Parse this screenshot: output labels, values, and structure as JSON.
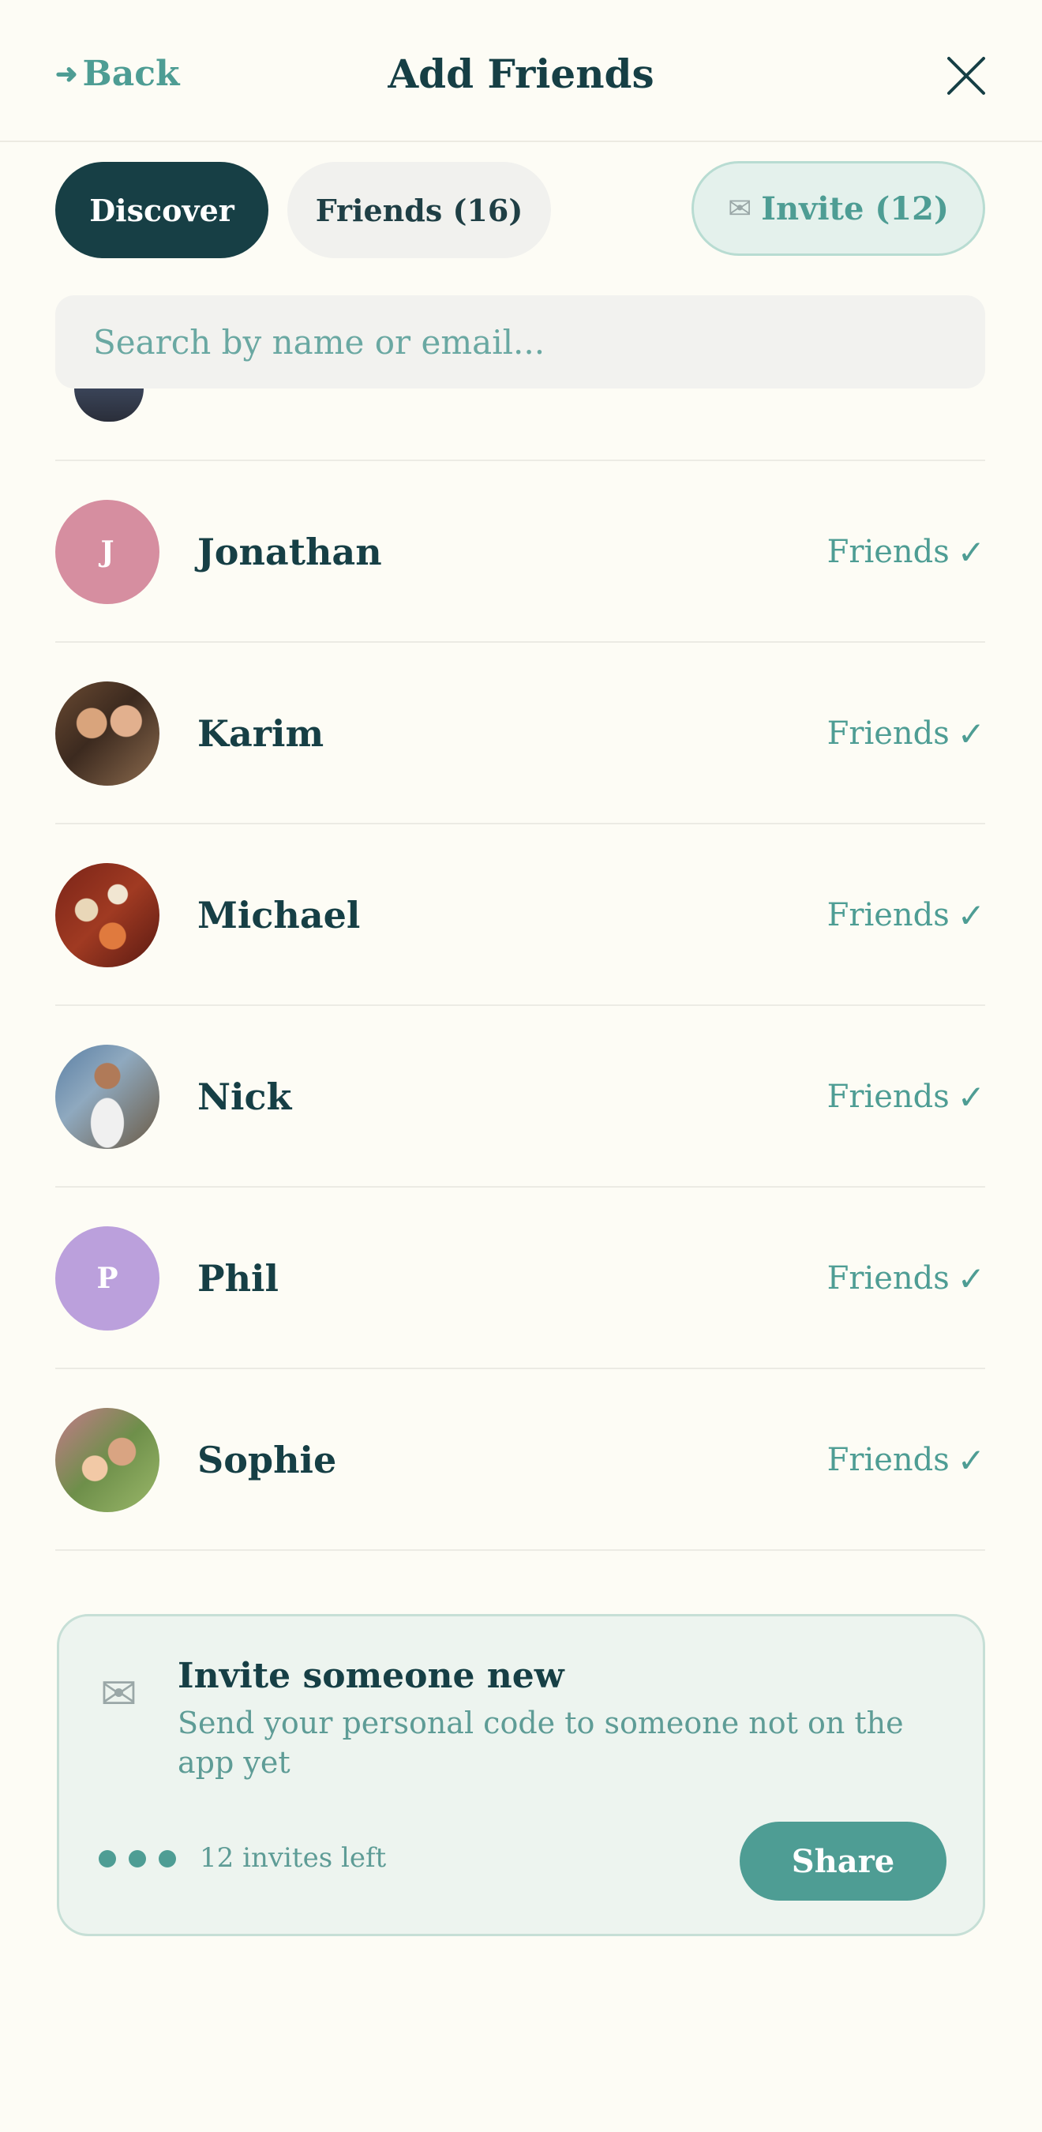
{
  "header": {
    "back_label": "Back",
    "title": "Add Friends"
  },
  "tabs": {
    "discover": "Discover",
    "friends": "Friends (16)",
    "invite": "Invite (12)"
  },
  "search": {
    "placeholder": "Search by name or email..."
  },
  "friends": [
    {
      "name": "Jonathan",
      "initial": "J",
      "status": "Friends",
      "avatar_type": "initial",
      "color": "#d68ea0"
    },
    {
      "name": "Karim",
      "initial": "",
      "status": "Friends",
      "avatar_type": "photo"
    },
    {
      "name": "Michael",
      "initial": "",
      "status": "Friends",
      "avatar_type": "photo"
    },
    {
      "name": "Nick",
      "initial": "",
      "status": "Friends",
      "avatar_type": "photo"
    },
    {
      "name": "Phil",
      "initial": "P",
      "status": "Friends",
      "avatar_type": "initial",
      "color": "#bba0dc"
    },
    {
      "name": "Sophie",
      "initial": "",
      "status": "Friends",
      "avatar_type": "photo"
    }
  ],
  "invite_card": {
    "title": "Invite someone new",
    "subtitle": "Send your personal code to someone not on the app yet",
    "invites_left": "12 invites left",
    "share_label": "Share"
  },
  "colors": {
    "accent": "#4e9d94",
    "dark": "#163f45",
    "background": "#fdfcf5"
  },
  "icons": {
    "back": "arrow-left-icon",
    "close": "close-icon",
    "invite": "envelope-icon",
    "check": "checkmark-icon"
  }
}
